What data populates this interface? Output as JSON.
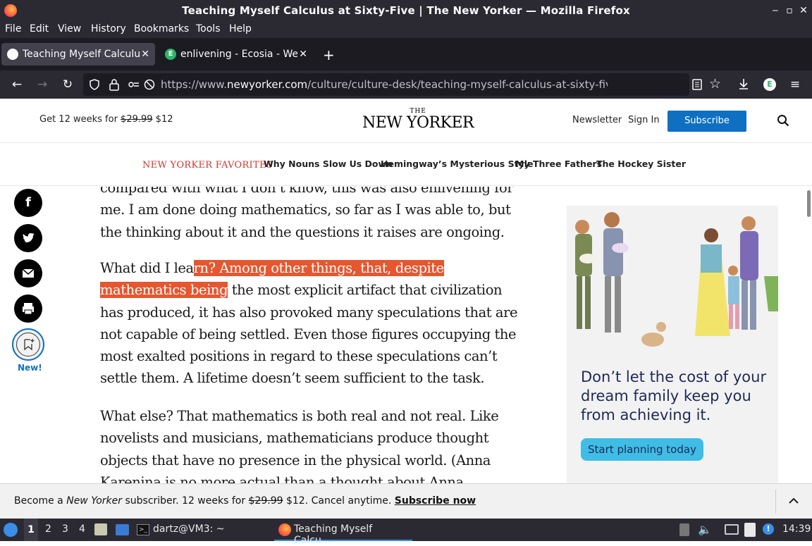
{
  "window": {
    "title": "Teaching Myself Calculus at Sixty-Five | The New Yorker — Mozilla Firefox"
  },
  "menu": [
    "File",
    "Edit",
    "View",
    "History",
    "Bookmarks",
    "Tools",
    "Help"
  ],
  "tabs": [
    {
      "label": "Teaching Myself Calculus at Sixty-Five"
    },
    {
      "label": "enlivening - Ecosia - Web"
    }
  ],
  "urlbar": {
    "prefix": "https://www.",
    "domain": "newyorker.com",
    "path": "/culture/culture-desk/teaching-myself-calculus-at-sixty-five?utm_source=pocket"
  },
  "site": {
    "promo_pre": "Get 12 weeks for ",
    "promo_old": "$29.99",
    "promo_new": " $12",
    "logo_the": "THE",
    "logo": "NEW YORKER",
    "newsletter": "Newsletter",
    "signin": "Sign In",
    "subscribe": "Subscribe"
  },
  "favorites": {
    "label": "NEW YORKER FAVORITES",
    "links": [
      "Why Nouns Slow Us Down",
      "Hemingway’s Mysterious Style",
      "My Three Fathers",
      "The Hockey Sister"
    ]
  },
  "article": {
    "p1": [
      "compared with what I don’t know, this was also enlivening for",
      "me. I am done doing mathematics, so far as I was able to, but",
      "the thinking about it and the questions it raises are ongoing."
    ],
    "p2_l1_pre": "What did I lea",
    "p2_l1_hl": "rn? Among other things, that, despite ",
    "p2_l2_hl": "mathematics being",
    "p2_l2_post": " the most explicit artifact that civilization",
    "p2_rest": [
      "has produced, it has also provoked many speculations that are",
      "not capable of being settled. Even those figures occupying the",
      "most exalted positions in regard to these speculations can’t",
      "settle them. A lifetime doesn’t seem sufficient to the task."
    ],
    "p3": [
      "What else? That mathematics is both real and not real. Like",
      "novelists and musicians, mathematicians produce thought",
      "objects that have no presence in the physical world. (Anna",
      "Karenina is no more actual than a thought about Anna"
    ]
  },
  "share": {
    "facebook": "f",
    "new_label": "New!"
  },
  "ad": {
    "text": "Don’t let the cost of your dream family keep you from achieving it.",
    "button": "Start planning today"
  },
  "subbar": {
    "pre": "Become a ",
    "brand": "New Yorker",
    "mid": " subscriber. 12 weeks for ",
    "old": "$29.99",
    "post": " $12. Cancel anytime. ",
    "link": "Subscribe now"
  },
  "taskbar": {
    "workspaces": [
      "1",
      "2",
      "3",
      "4"
    ],
    "terminal": "dartz@VM3: ~",
    "firefox": "Teaching Myself Calcu…",
    "clock": "14:39"
  },
  "colors": {
    "accent": "#0f70c2",
    "highlight": "#e6562f",
    "favorites": "#d0352b"
  }
}
